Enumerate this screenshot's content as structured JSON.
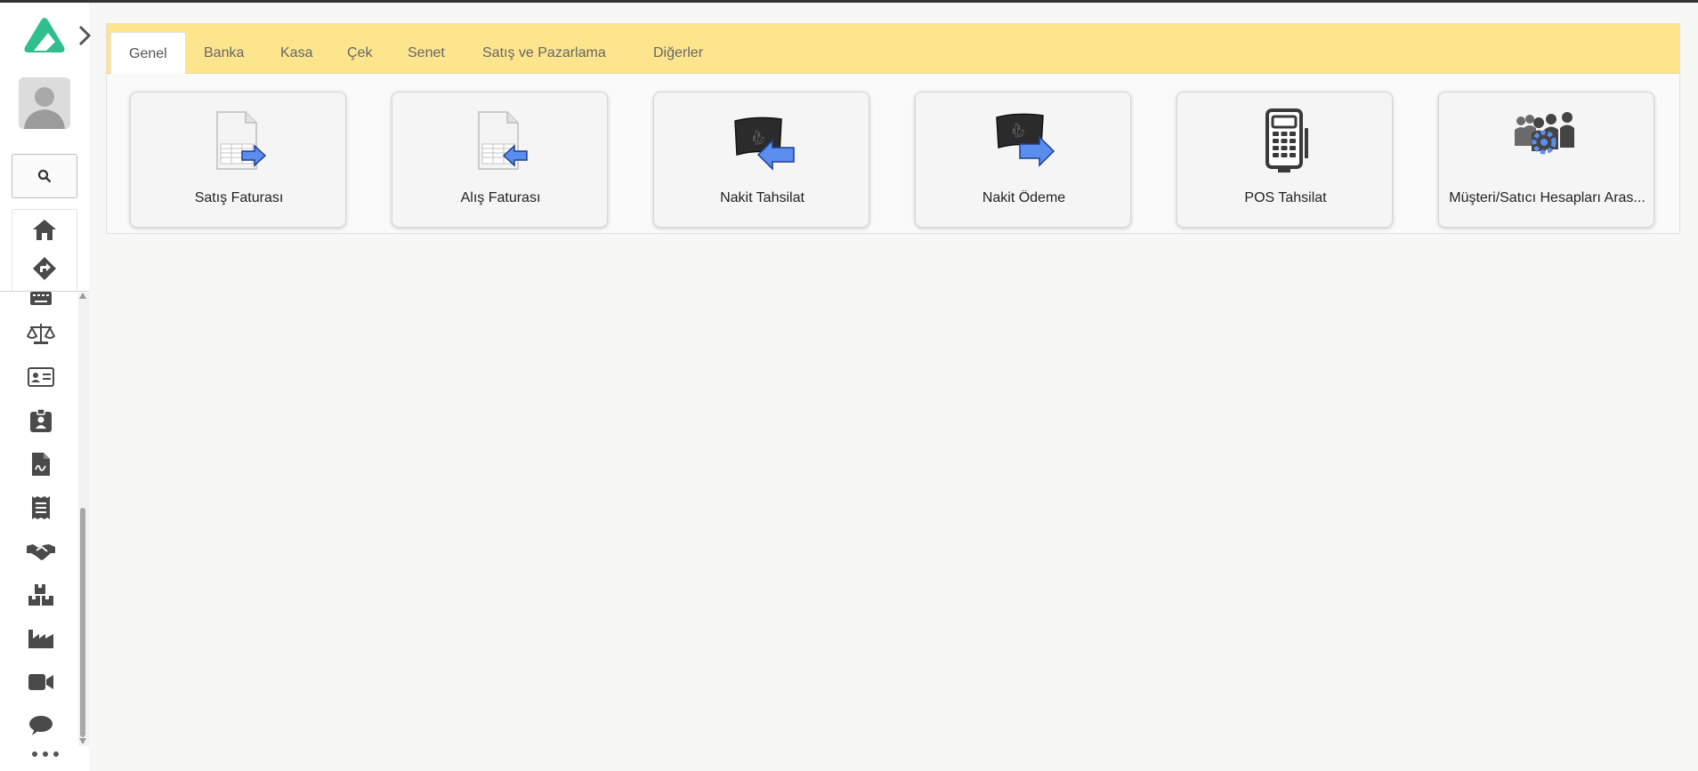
{
  "sidebar": {
    "logo_icon": "app-logo",
    "expand_icon": "chevron-right-icon",
    "avatar_icon": "user-avatar",
    "search_icon": "search-icon",
    "pinned": [
      {
        "icon": "home-icon"
      },
      {
        "icon": "directions-icon"
      }
    ],
    "menu": [
      {
        "icon": "keyboard-icon"
      },
      {
        "icon": "balance-scale-icon"
      },
      {
        "icon": "id-card-icon"
      },
      {
        "icon": "id-badge-icon"
      },
      {
        "icon": "file-signature-icon"
      },
      {
        "icon": "receipt-icon"
      },
      {
        "icon": "handshake-icon"
      },
      {
        "icon": "boxes-icon"
      },
      {
        "icon": "industry-icon"
      },
      {
        "icon": "video-icon"
      },
      {
        "icon": "comment-icon"
      }
    ],
    "more_icon": "ellipsis-icon"
  },
  "tabs": [
    {
      "label": "Genel",
      "active": true
    },
    {
      "label": "Banka"
    },
    {
      "label": "Kasa"
    },
    {
      "label": "Çek"
    },
    {
      "label": "Senet"
    },
    {
      "label": "Satış ve Pazarlama"
    },
    {
      "label": "Diğerler"
    }
  ],
  "cards": [
    {
      "label": "Satış Faturası",
      "icon": "sales-invoice-icon"
    },
    {
      "label": "Alış Faturası",
      "icon": "purchase-invoice-icon"
    },
    {
      "label": "Nakit Tahsilat",
      "icon": "cash-collection-icon"
    },
    {
      "label": "Nakit Ödeme",
      "icon": "cash-payment-icon"
    },
    {
      "label": "POS Tahsilat",
      "icon": "pos-terminal-icon"
    },
    {
      "label": "Müşteri/Satıcı Hesapları Aras...",
      "icon": "customer-vendor-transfer-icon"
    }
  ],
  "colors": {
    "tabbar": "#fde58e",
    "accent_green": "#2fbf8f",
    "arrow_blue": "#5b8def",
    "icon_dark": "#4a4a4a"
  }
}
